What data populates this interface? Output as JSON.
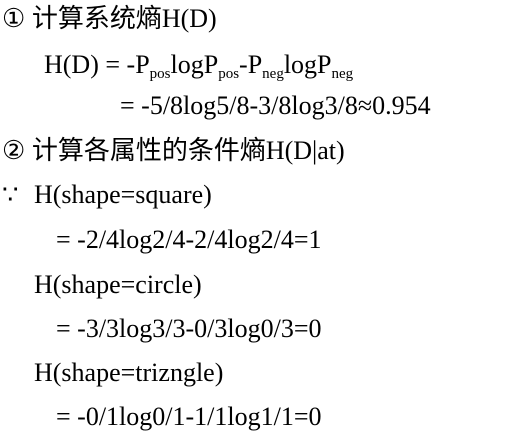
{
  "step1": {
    "marker": "①",
    "title": "计算系统熵",
    "expr": "H(D)"
  },
  "formula": {
    "lhs": "H(D) = -P",
    "sub_pos": "pos",
    "log1": "logP",
    "sub_pos2": "pos",
    "minus": "-P",
    "sub_neg": "neg",
    "log2": "logP",
    "sub_neg2": "neg",
    "result": "= -5/8log5/8-3/8log3/8≈0.954"
  },
  "step2": {
    "marker": "②",
    "title": "计算各属性的条件熵",
    "expr": "H(D|at)"
  },
  "because": "∵",
  "cases": [
    {
      "label": "H(shape=square)",
      "calc": "= -2/4log2/4-2/4log2/4=1"
    },
    {
      "label": "H(shape=circle)",
      "calc": "= -3/3log3/3-0/3log0/3=0"
    },
    {
      "label": "H(shape=trizngle)",
      "calc": "= -0/1log0/1-1/1log1/1=0"
    }
  ]
}
